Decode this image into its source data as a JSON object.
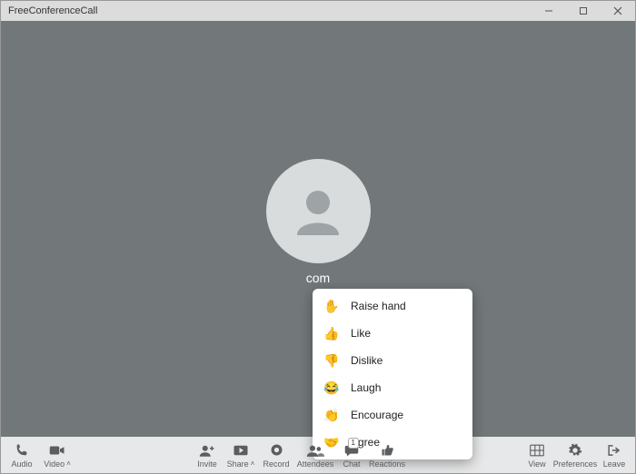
{
  "window": {
    "title": "FreeConferenceCall"
  },
  "participant": {
    "display_name": "com"
  },
  "reactions": [
    {
      "emoji": "✋",
      "label": "Raise hand"
    },
    {
      "emoji": "👍",
      "label": "Like"
    },
    {
      "emoji": "👎",
      "label": "Dislike"
    },
    {
      "emoji": "😂",
      "label": "Laugh"
    },
    {
      "emoji": "👏",
      "label": "Encourage"
    },
    {
      "emoji": "🤝",
      "label": "Agree"
    }
  ],
  "toolbar": {
    "audio": "Audio",
    "video": "Video",
    "invite": "Invite",
    "share": "Share",
    "record": "Record",
    "attendees": "Attendees",
    "chat": "Chat",
    "chat_badge": "1",
    "reactions": "Reactions",
    "view": "View",
    "preferences": "Preferences",
    "leave": "Leave"
  }
}
